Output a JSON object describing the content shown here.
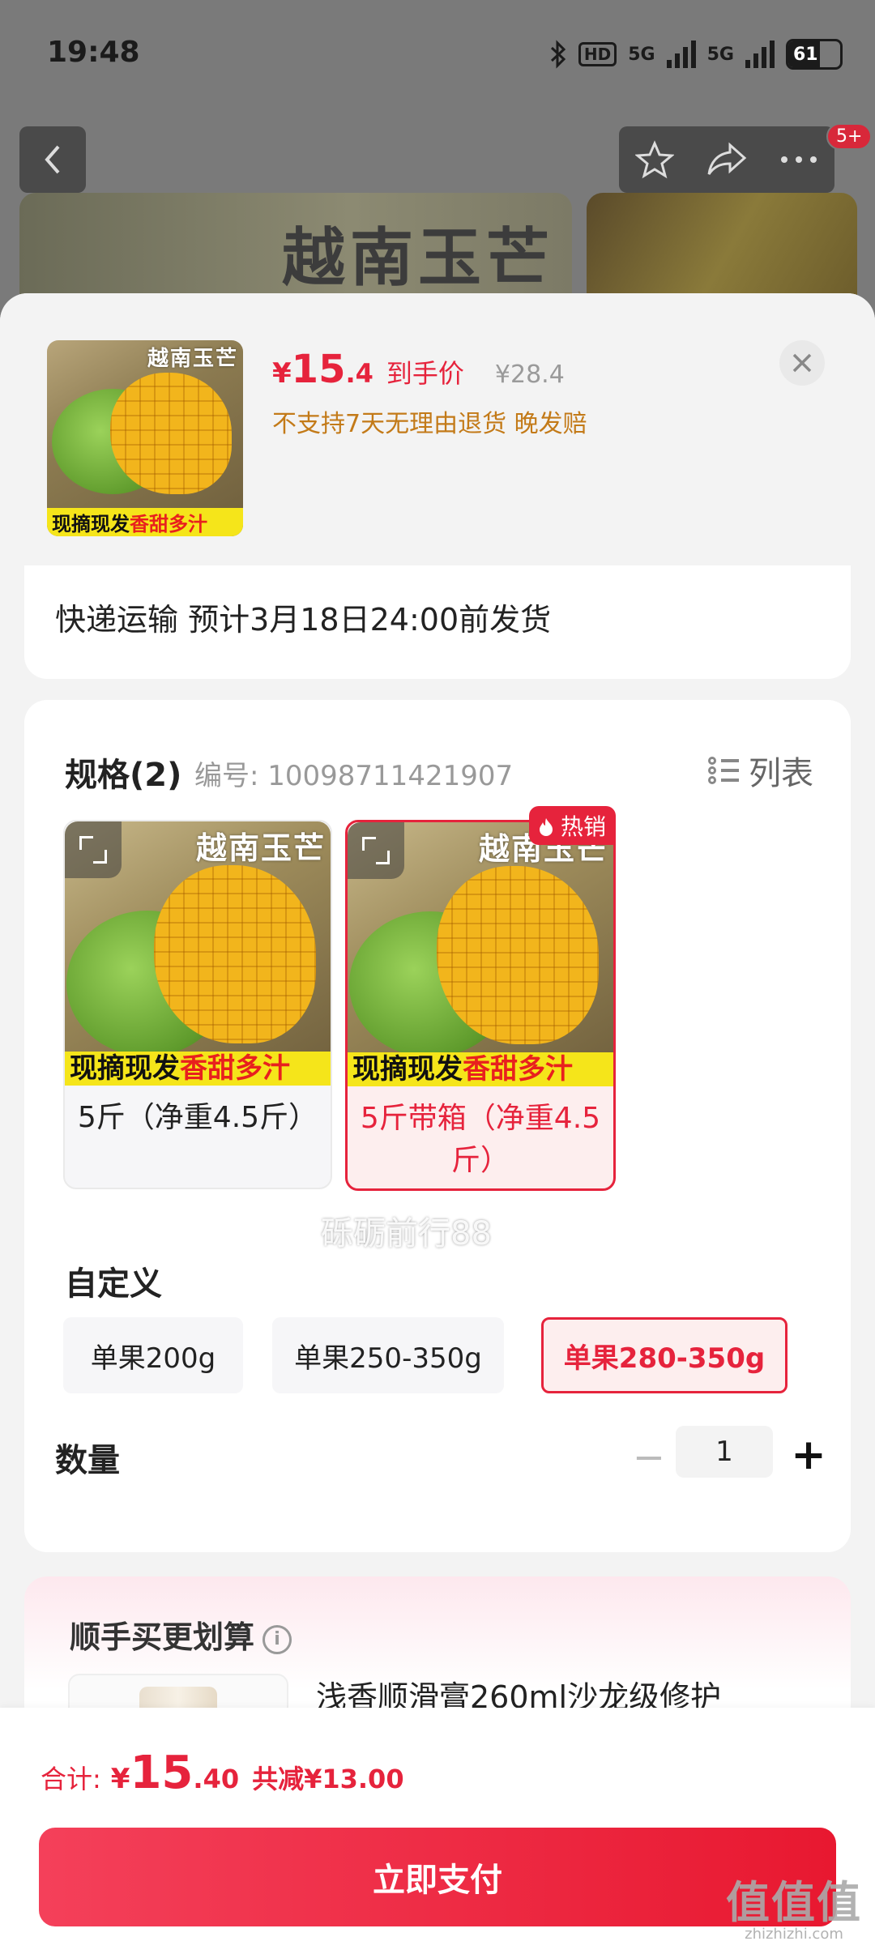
{
  "status_bar": {
    "time": "19:48",
    "hd_label": "HD",
    "net1": "5G",
    "net2": "5G",
    "battery": "61",
    "battery_level": 0.61
  },
  "background_page": {
    "banner_title": "越南玉芒",
    "cart_badge": "5+"
  },
  "header": {
    "thumb_title": "越南玉芒",
    "thumb_caption_a": "现摘现发",
    "thumb_caption_b": "香甜多汁",
    "price_yen": "¥",
    "price_int": "15",
    "price_dec": ".4",
    "price_label": "到手价",
    "price_original": "¥28.4",
    "policy": "不支持7天无理由退货  晚发赔"
  },
  "shipping": {
    "text": "快递运输 预计3月18日24:00前发货"
  },
  "spec": {
    "title": "规格(2)",
    "code": "编号: 10098711421907",
    "list_label": "列表",
    "options": [
      {
        "img_title": "越南玉芒",
        "caption_a": "现摘现发",
        "caption_b": "香甜多汁",
        "label": "5斤（净重4.5斤）",
        "selected": false
      },
      {
        "img_title": "越南玉芒",
        "caption_a": "现摘现发",
        "caption_b": "香甜多汁",
        "label": "5斤带箱（净重4.5斤）",
        "selected": true,
        "badge": "热销"
      }
    ],
    "watermark": "砾砺前行88"
  },
  "custom": {
    "title": "自定义",
    "options": [
      {
        "label": "单果200g",
        "selected": false
      },
      {
        "label": "单果250-350g",
        "selected": false
      },
      {
        "label": "单果280-350g",
        "selected": true
      }
    ]
  },
  "quantity": {
    "title": "数量",
    "value": "1",
    "minus": "−",
    "plus": "+"
  },
  "bundle": {
    "title": "顺手买更划算",
    "info": "i",
    "item_name": "浅香顺滑膏260ml沙龙级修护"
  },
  "footer": {
    "total_label": "合计:",
    "total_yen": "¥",
    "total_int": "15",
    "total_dec": ".40",
    "total_discount": "共减¥13.00",
    "pay_label": "立即支付"
  },
  "site_watermark": {
    "big": "值值值",
    "small": "zhizhizhi.com"
  },
  "colors": {
    "accent": "#e6233c",
    "policy": "#c37a18",
    "sheet_bg": "#f3f3f3"
  }
}
